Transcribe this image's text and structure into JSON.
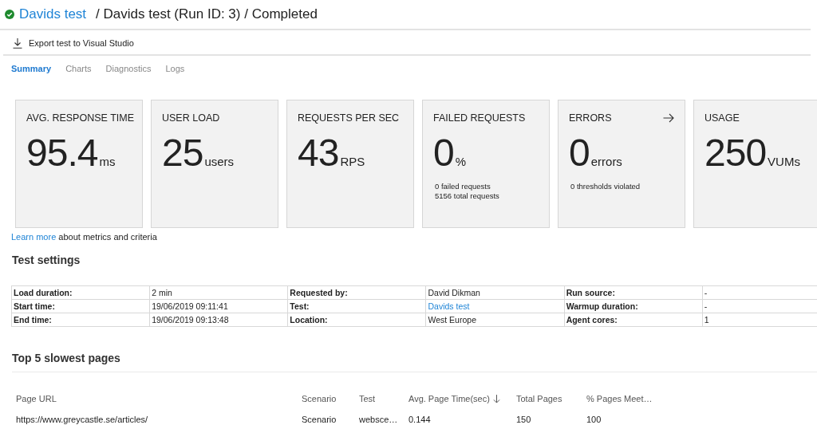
{
  "header": {
    "passed": true,
    "test_link": "Davids test",
    "trail": "/ Davids test (Run ID: 3) / Completed"
  },
  "toolbar": {
    "export_button": "Export test to Visual Studio"
  },
  "tabs": [
    {
      "label": "Summary",
      "selected": true
    },
    {
      "label": "Charts",
      "selected": false
    },
    {
      "label": "Diagnostics",
      "selected": false
    },
    {
      "label": "Logs",
      "selected": false
    }
  ],
  "metrics": [
    {
      "label": "AVG. RESPONSE TIME",
      "value": "95.4",
      "unit": "ms"
    },
    {
      "label": "USER LOAD",
      "value": "25",
      "unit": "users"
    },
    {
      "label": "REQUESTS PER SEC",
      "value": "43",
      "unit": "RPS"
    },
    {
      "label": "FAILED REQUESTS",
      "value": "0",
      "unit": "%",
      "notes": [
        "0 failed requests",
        "5156 total requests"
      ]
    },
    {
      "label": "ERRORS",
      "value": "0",
      "unit": "errors",
      "notes": [
        "0 thresholds violated"
      ],
      "navigable": true
    },
    {
      "label": "USAGE",
      "value": "250",
      "unit": "VUMs"
    }
  ],
  "learn_more": {
    "link": "Learn more",
    "text": "about metrics and criteria"
  },
  "test_settings": {
    "title": "Test settings",
    "rows": [
      [
        {
          "kind": "label",
          "text": "Load duration:"
        },
        {
          "kind": "value",
          "text": "2 min"
        },
        {
          "kind": "label",
          "text": "Requested by:"
        },
        {
          "kind": "value",
          "text": "David Dikman"
        },
        {
          "kind": "label",
          "text": "Run source:"
        },
        {
          "kind": "value",
          "text": "-"
        }
      ],
      [
        {
          "kind": "label",
          "text": "Start time:"
        },
        {
          "kind": "value",
          "text": "19/06/2019 09:11:41"
        },
        {
          "kind": "label",
          "text": "Test:"
        },
        {
          "kind": "link",
          "text": "Davids test"
        },
        {
          "kind": "label",
          "text": "Warmup duration:"
        },
        {
          "kind": "value",
          "text": "-"
        }
      ],
      [
        {
          "kind": "label",
          "text": "End time:"
        },
        {
          "kind": "value",
          "text": "19/06/2019 09:13:48"
        },
        {
          "kind": "label",
          "text": "Location:"
        },
        {
          "kind": "value",
          "text": "West Europe"
        },
        {
          "kind": "label",
          "text": "Agent cores:"
        },
        {
          "kind": "value",
          "text": "1"
        }
      ]
    ]
  },
  "slowest_pages": {
    "title": "Top 5 slowest pages",
    "columns": [
      {
        "label": "Page URL",
        "sorted": false
      },
      {
        "label": "Scenario",
        "sorted": false
      },
      {
        "label": "Test",
        "sorted": false
      },
      {
        "label": "Avg. Page Time(sec)",
        "sorted": true
      },
      {
        "label": "Total Pages",
        "sorted": false
      },
      {
        "label": "% Pages Meet…",
        "sorted": false
      }
    ],
    "rows": [
      [
        "https://www.greycastle.se/articles/",
        "Scenario",
        "websce…",
        "0.144",
        "150",
        "100"
      ]
    ]
  }
}
